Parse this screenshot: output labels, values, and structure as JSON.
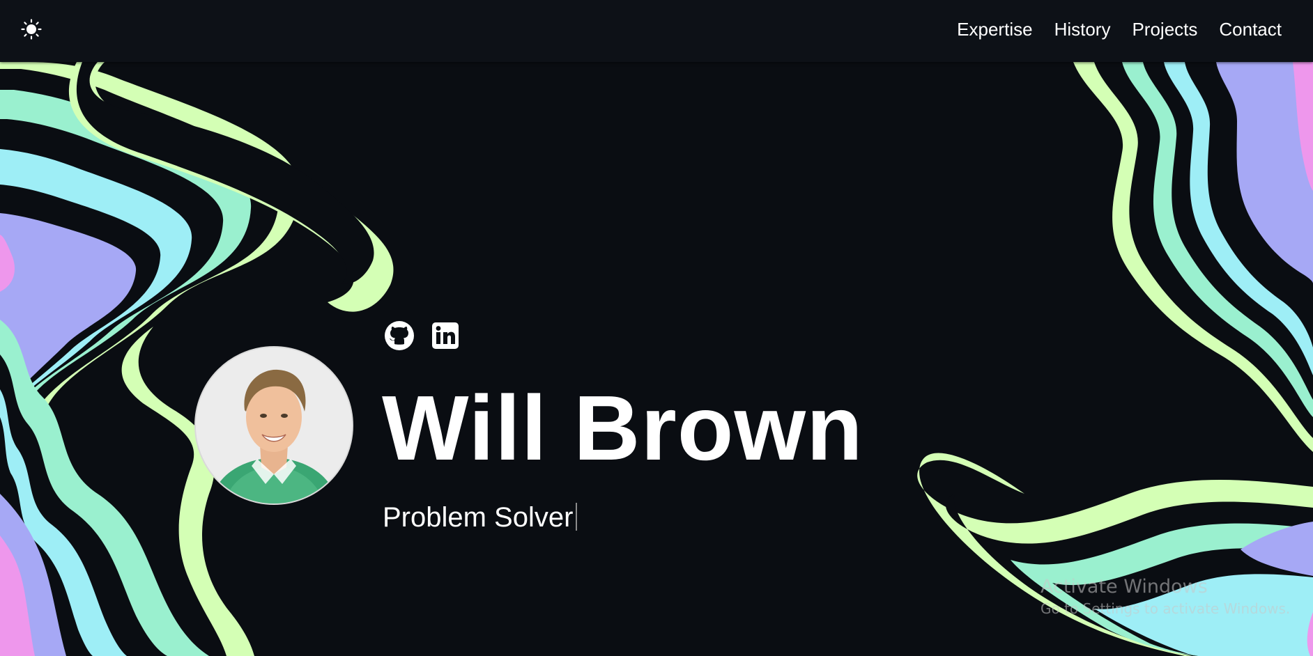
{
  "header": {
    "theme_icon": "sun-icon",
    "nav": [
      {
        "label": "Expertise"
      },
      {
        "label": "History"
      },
      {
        "label": "Projects"
      },
      {
        "label": "Contact"
      }
    ]
  },
  "hero": {
    "name": "Will Brown",
    "tagline": "Problem Solver",
    "avatar_icon": "profile-photo",
    "socials": [
      {
        "icon": "github-icon"
      },
      {
        "icon": "linkedin-icon"
      }
    ]
  },
  "watermark": {
    "title": "Activate Windows",
    "subtitle": "Go to Settings to activate Windows."
  },
  "colors": {
    "background": "#0a0d12",
    "header": "#0d1117",
    "lime": "#d4ffb5",
    "mint": "#9af0cf",
    "cyan": "#9eeef6",
    "lavender": "#a6a8f5",
    "pink": "#ee97ec"
  }
}
